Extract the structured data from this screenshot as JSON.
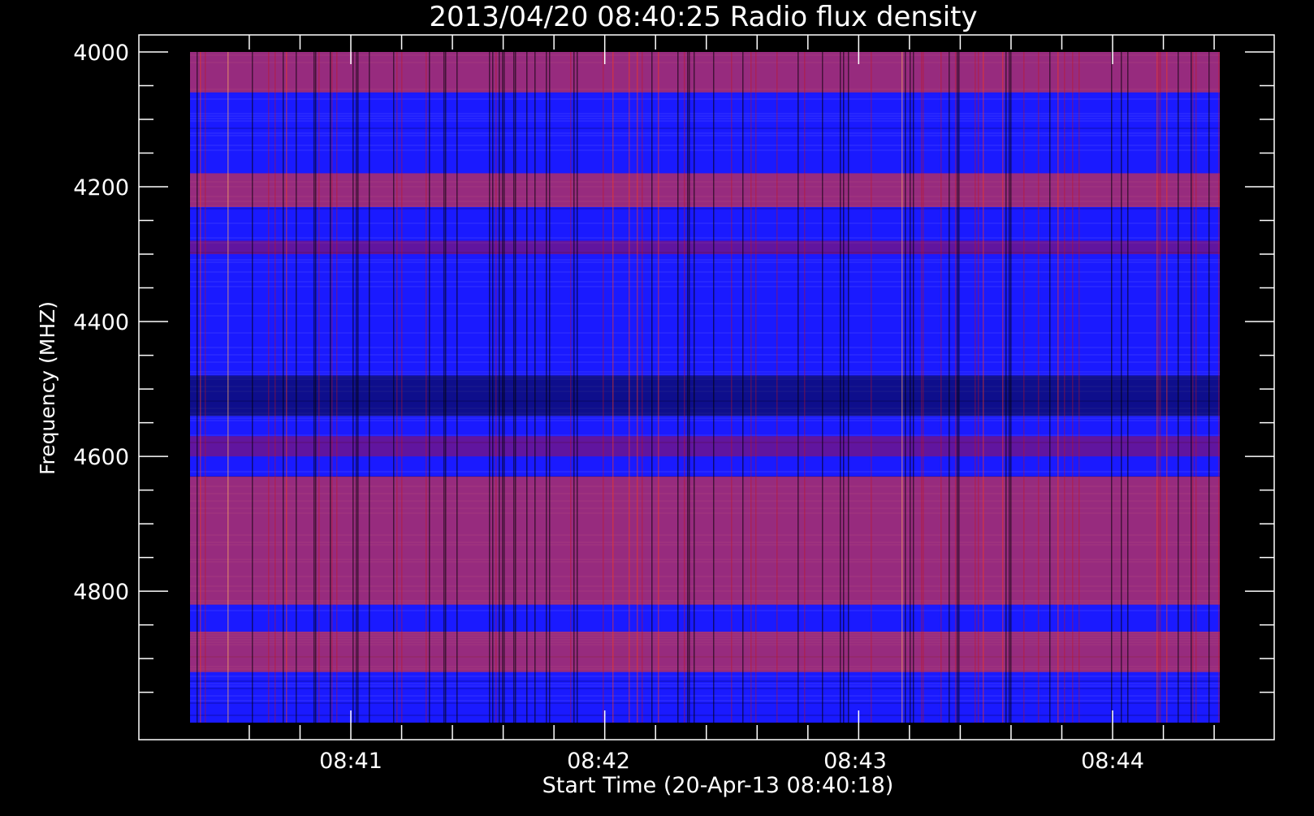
{
  "chart_data": {
    "type": "heatmap",
    "title": "2013/04/20 08:40:25 Radio flux density",
    "xlabel": "Start Time (20-Apr-13 08:40:18)",
    "ylabel": "Frequency (MHZ)",
    "ylim": [
      4000,
      4995
    ],
    "y_inverted": true,
    "y_ticks": [
      4000,
      4200,
      4400,
      4600,
      4800
    ],
    "y_tick_labels": [
      "4000",
      "4200",
      "4400",
      "4600",
      "4800"
    ],
    "x_ticks": [
      "08:41",
      "08:42",
      "08:43",
      "08:44"
    ],
    "x_range": [
      "08:40:18",
      "08:44:21"
    ],
    "colormap": [
      "#000000",
      "#1a1aff",
      "#3030ff",
      "#cc1010",
      "#ff3a14",
      "#ffb060"
    ],
    "bands": [
      {
        "from": 4000,
        "to": 4060,
        "level": "high"
      },
      {
        "from": 4180,
        "to": 4230,
        "level": "high"
      },
      {
        "from": 4280,
        "to": 4300,
        "level": "medium"
      },
      {
        "from": 4480,
        "to": 4540,
        "level": "low"
      },
      {
        "from": 4570,
        "to": 4600,
        "level": "medium"
      },
      {
        "from": 4630,
        "to": 4820,
        "level": "high"
      },
      {
        "from": 4860,
        "to": 4920,
        "level": "high"
      }
    ]
  }
}
